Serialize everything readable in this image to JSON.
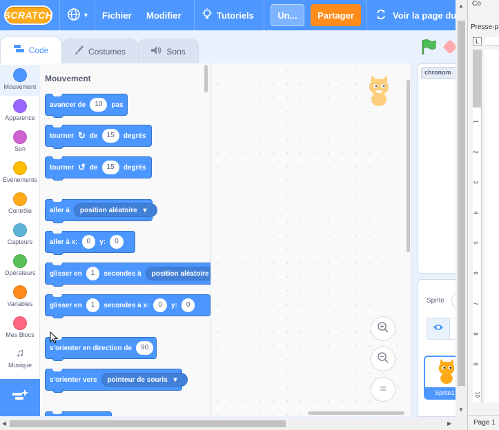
{
  "menubar": {
    "logo": "SCRATCH",
    "file": "Fichier",
    "edit": "Modifier",
    "tutorials": "Tutoriels",
    "project_title": "Un...",
    "share": "Partager",
    "see_project_page": "Voir la page du",
    "accent_color": "#4d97ff"
  },
  "tabs": {
    "code": "Code",
    "costumes": "Costumes",
    "sounds": "Sons"
  },
  "categories": [
    {
      "label": "Mouvement",
      "color": "#4c97ff"
    },
    {
      "label": "Apparence",
      "color": "#9966ff"
    },
    {
      "label": "Son",
      "color": "#cf63cf"
    },
    {
      "label": "Événements",
      "color": "#ffbf00"
    },
    {
      "label": "Contrôle",
      "color": "#ffab19"
    },
    {
      "label": "Capteurs",
      "color": "#5cb1d6"
    },
    {
      "label": "Opérateurs",
      "color": "#59c059"
    },
    {
      "label": "Variables",
      "color": "#ff8c1a"
    },
    {
      "label": "Mes Blocs",
      "color": "#ff6680"
    },
    {
      "label": "Musique",
      "color": "#ffffff"
    }
  ],
  "palette": {
    "title": "Mouvement",
    "blocks": {
      "move": {
        "a": "avancer de",
        "v": "10",
        "b": "pas"
      },
      "turn_right": {
        "a": "tourner",
        "of": "de",
        "v": "15",
        "b": "degrés"
      },
      "turn_left": {
        "a": "tourner",
        "of": "de",
        "v": "15",
        "b": "degrés"
      },
      "goto": {
        "a": "aller à",
        "menu": "position aléatoire"
      },
      "goto_xy": {
        "a": "aller à x:",
        "x": "0",
        "yl": "y:",
        "y": "0"
      },
      "glide": {
        "a": "glisser en",
        "v": "1",
        "b": "secondes à",
        "menu": "position aléatoire"
      },
      "glide_xy": {
        "a": "glisser en",
        "v": "1",
        "b": "secondes à x:",
        "x": "0",
        "yl": "y:",
        "y": "0"
      },
      "point_dir": {
        "a": "s'orienter en direction de",
        "v": "90"
      },
      "point_towards": {
        "a": "s'orienter vers",
        "menu": "pointeur de souris"
      }
    }
  },
  "zoom": {
    "in": "+",
    "out": "−",
    "reset": "="
  },
  "stage": {
    "monitor": "chronom"
  },
  "sprite_pane": {
    "label": "Sprite",
    "sprite_name": "Sprite1"
  },
  "word": {
    "top": "Co",
    "clipboard": "Presse-p",
    "ruler_corner": "L",
    "status": "Page 1"
  }
}
